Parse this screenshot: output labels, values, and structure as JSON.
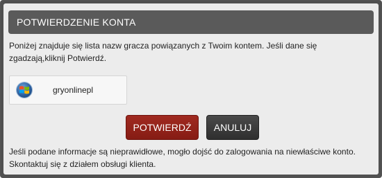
{
  "dialog": {
    "title": "POTWIERDZENIE KONTA",
    "intro_line1": "Poniżej znajduje się lista nazw gracza powiązanych z Twoim kontem. Jeśli dane się",
    "intro_line2": "zgadzają,kliknij Potwierdź."
  },
  "account": {
    "icon": "windows-logo-icon",
    "name": "gryonlinepl"
  },
  "buttons": {
    "confirm_label": "POTWIERDŹ",
    "cancel_label": "ANULUJ"
  },
  "footer": {
    "line1": "Jeśli podane informacje są nieprawidłowe, mogło dojść do zalogowania na niewłaściwe konto.",
    "line2": "Skontaktuj się z działem obsługi klienta."
  },
  "colors": {
    "title_bar": "#5a5a5a",
    "confirm_button": "#9a261c",
    "cancel_button": "#3c3c3c",
    "dialog_background": "#ececec"
  }
}
